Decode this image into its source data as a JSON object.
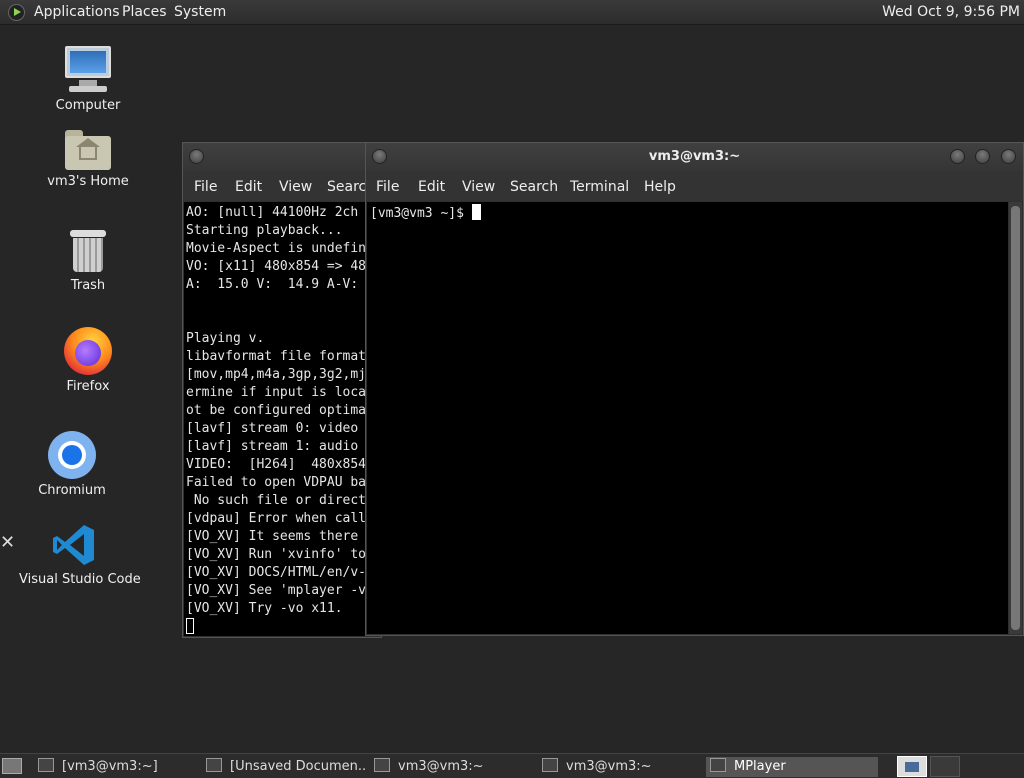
{
  "top_panel": {
    "menus": [
      "Applications",
      "Places",
      "System"
    ],
    "clock": "Wed Oct  9,  9:56 PM"
  },
  "desktop_icons": [
    {
      "label": "Computer",
      "icon": "computer-icon"
    },
    {
      "label": "vm3's Home",
      "icon": "home-folder-icon"
    },
    {
      "label": "Trash",
      "icon": "trash-icon"
    },
    {
      "label": "Firefox",
      "icon": "firefox-icon"
    },
    {
      "label": "Chromium",
      "icon": "chromium-icon"
    },
    {
      "label": "Visual Studio Code",
      "icon": "vscode-icon"
    }
  ],
  "back_terminal": {
    "menu": [
      "File",
      "Edit",
      "View",
      "Search"
    ],
    "lines": [
      "AO: [null] 44100Hz 2ch",
      "Starting playback...",
      "Movie-Aspect is undefin",
      "VO: [x11] 480x854 => 48",
      "A:  15.0 V:  14.9 A-V:",
      "",
      "",
      "Playing v.",
      "libavformat file format",
      "[mov,mp4,m4a,3gp,3g2,mj",
      "ermine if input is loca",
      "ot be configured optima",
      "[lavf] stream 0: video",
      "[lavf] stream 1: audio",
      "VIDEO:  [H264]  480x854",
      "Failed to open VDPAU ba",
      " No such file or direct",
      "[vdpau] Error when call",
      "[VO_XV] It seems there",
      "[VO_XV] Run 'xvinfo' to",
      "[VO_XV] DOCS/HTML/en/v-",
      "[VO_XV] See 'mplayer -v",
      "[VO_XV] Try -vo x11."
    ]
  },
  "front_terminal": {
    "title": "vm3@vm3:~",
    "menu": [
      "File",
      "Edit",
      "View",
      "Search",
      "Terminal",
      "Help"
    ],
    "prompt": "[vm3@vm3 ~]$ "
  },
  "taskbar": {
    "tasks": [
      {
        "label": "[vm3@vm3:~]",
        "icon": "terminal-icon",
        "active": false
      },
      {
        "label": "[Unsaved Documen...",
        "icon": "text-editor-icon",
        "active": false
      },
      {
        "label": "vm3@vm3:~",
        "icon": "terminal-icon",
        "active": false
      },
      {
        "label": "vm3@vm3:~",
        "icon": "terminal-icon",
        "active": false
      },
      {
        "label": "MPlayer",
        "icon": "mplayer-icon",
        "active": true
      }
    ]
  }
}
